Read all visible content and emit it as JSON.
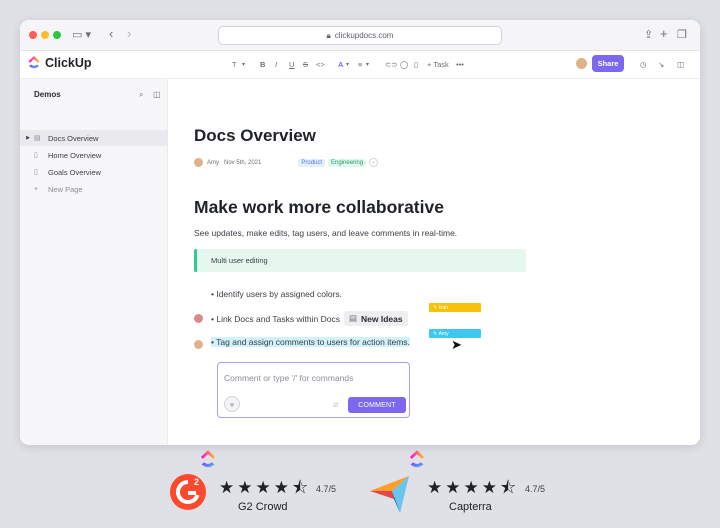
{
  "browser": {
    "url": "clickupdocs.com"
  },
  "app": {
    "name": "ClickUp",
    "share_label": "Share",
    "toolbar": {
      "text_style": "T",
      "bold": "B",
      "italic": "I",
      "underline": "U",
      "strike": "S",
      "code": "<>",
      "color": "A",
      "align": "≡",
      "task": "+ Task",
      "more": "•••"
    }
  },
  "sidebar": {
    "title": "Demos",
    "items": [
      {
        "label": "Docs Overview",
        "active": true
      },
      {
        "label": "Home Overview",
        "active": false
      },
      {
        "label": "Goals Overview",
        "active": false
      }
    ],
    "add_page": "New Page"
  },
  "doc": {
    "title": "Docs Overview",
    "author": "Amy",
    "date": "Nov 5th, 2021",
    "tags": [
      "Product",
      "Engineering"
    ],
    "heading": "Make work more collaborative",
    "subtitle": "See updates, make edits, tag users, and leave comments in real-time.",
    "callout": "Multi user editing",
    "bullets": [
      "• Identify users by assigned colors.",
      "• Link Docs and Tasks within Docs",
      "• Tag and assign comments to users for action items."
    ],
    "chip": "New Ideas",
    "cursors": [
      {
        "name": "Ivan",
        "color": "#f8c20a"
      },
      {
        "name": "Amy",
        "color": "#3ec8f0"
      }
    ],
    "comment_placeholder": "Comment or type '/' for commands",
    "comment_button": "COMMENT"
  },
  "reviews": [
    {
      "source": "G2 Crowd",
      "rating": "4.7/5"
    },
    {
      "source": "Capterra",
      "rating": "4.7/5"
    }
  ],
  "colors": {
    "accent": "#7b68ee",
    "callout_border": "#2ecd8d",
    "highlight": "#d1f1fb"
  }
}
